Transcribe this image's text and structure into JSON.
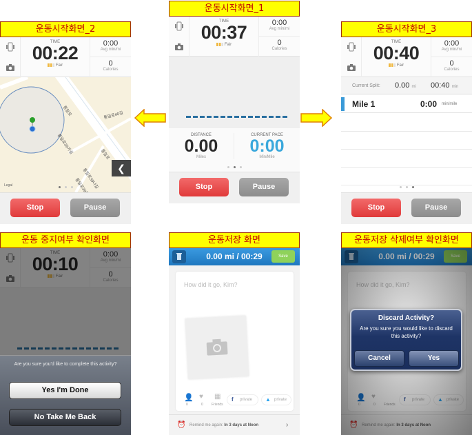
{
  "common": {
    "time_label": "TIME",
    "signal": "Fair",
    "avg": "0:00",
    "avg_label": "Avg min/mi",
    "calories": "0",
    "calories_label": "Calories",
    "stop": "Stop",
    "pause": "Pause"
  },
  "start1": {
    "title": "운동시작화면_1",
    "time": "00:37",
    "distance_label": "DISTANCE",
    "distance": "0.00",
    "distance_unit": "Miles",
    "pace_label": "CURRENT PACE",
    "pace": "0:00",
    "pace_unit": "Min/Mile"
  },
  "start2": {
    "title": "운동시작화면_2",
    "time": "00:22",
    "map_labels": [
      "통일로",
      "통일로40길",
      "통일로39가길",
      "통일로",
      "통일로39나길",
      "통일로39길"
    ],
    "legal": "Legal"
  },
  "start3": {
    "title": "운동시작화면_3",
    "time": "00:40",
    "split_label": "Current Split:",
    "split_distance": "0.00",
    "split_distance_unit": "mi",
    "split_time": "00:40",
    "split_time_unit": "min",
    "mile_label": "Mile 1",
    "mile_pace": "0:00",
    "mile_pace_unit": "min/mile"
  },
  "stop_confirm": {
    "title": "운동 중지여부 확인화면",
    "time": "00:10",
    "question": "Are you sure you'd like to complete this activity?",
    "yes": "Yes I'm Done",
    "no": "No Take Me Back"
  },
  "save": {
    "title": "운동저장 화면",
    "summary": "0.00 mi / 00:29",
    "save_button": "Save",
    "placeholder": "How did it go, Kim?",
    "tag_count": "0",
    "like_count": "0",
    "friends_label": "Friends",
    "facebook_privacy": "private",
    "twitter_privacy": "private",
    "remind_label": "Remind me again:",
    "remind_value": "In 3 days at Noon"
  },
  "discard": {
    "title": "운동저장 삭제여부 확인화면",
    "dialog_title": "Discard Activity?",
    "dialog_message": "Are you sure you would like to discard this activity?",
    "cancel": "Cancel",
    "yes": "Yes"
  },
  "colors": {
    "title_bg": "#ffff00",
    "title_text": "#c00000",
    "stop_red": "#e8484a",
    "pace_blue": "#3aa8dc",
    "header_blue": "#2a88d0",
    "save_green": "#8fd25a"
  }
}
